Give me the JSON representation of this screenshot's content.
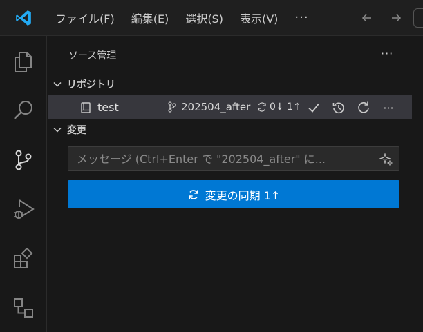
{
  "menu": {
    "items": [
      "ファイル(F)",
      "編集(E)",
      "選択(S)",
      "表示(V)"
    ],
    "more": "···"
  },
  "icons": {
    "logo": "vscode-logo-icon",
    "back": "arrow-left-icon",
    "forward": "arrow-right-icon",
    "explorer": "files-icon",
    "search": "search-icon",
    "scm": "source-control-icon",
    "debug": "run-debug-icon",
    "extensions": "extensions-icon",
    "remote": "remote-explorer-icon"
  },
  "panel": {
    "title": "ソース管理",
    "more": "···"
  },
  "repositories": {
    "header": "リポジトリ",
    "repo": {
      "name": "test",
      "branch": "202504_after",
      "sync": "0↓ 1↑",
      "more": "···"
    }
  },
  "changes": {
    "header": "変更",
    "commit_placeholder": "メッセージ (Ctrl+Enter で \"202504_after\" に...",
    "sync_button": "変更の同期 1↑"
  },
  "colors": {
    "accent": "#0078d4",
    "logo": "#23a9f2",
    "background": "#181818"
  }
}
